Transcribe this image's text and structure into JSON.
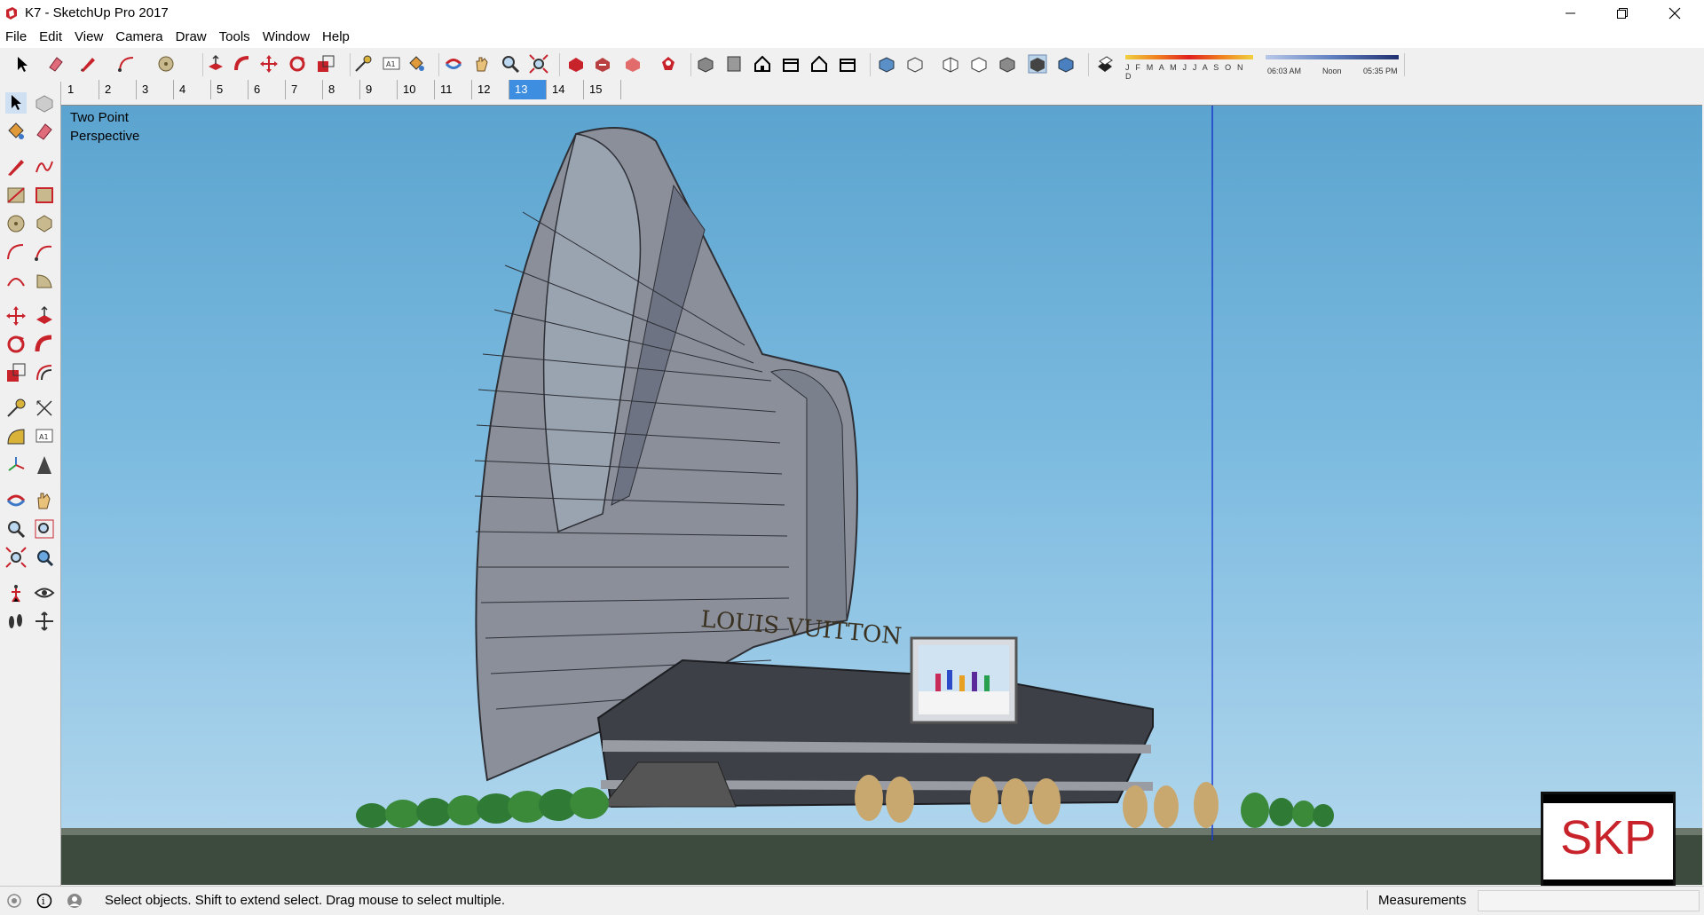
{
  "window": {
    "title": "K7 - SketchUp Pro 2017"
  },
  "menu": [
    "File",
    "Edit",
    "View",
    "Camera",
    "Draw",
    "Tools",
    "Window",
    "Help"
  ],
  "shadows": {
    "months": "J F M A M J J A S O N D",
    "sunrise": "06:03 AM",
    "noon": "Noon",
    "sunset": "05:35 PM"
  },
  "scenes": {
    "tabs": [
      "1",
      "2",
      "3",
      "4",
      "5",
      "6",
      "7",
      "8",
      "9",
      "10",
      "11",
      "12",
      "13",
      "14",
      "15"
    ],
    "active": "13"
  },
  "viewport": {
    "camera_label_line1": "Two Point",
    "camera_label_line2": "Perspective",
    "sign_text": "LOUIS VUITTON"
  },
  "badge": {
    "text": "SKP"
  },
  "status": {
    "hint": "Select objects. Shift to extend select. Drag mouse to select multiple.",
    "measurements_label": "Measurements"
  },
  "colors": {
    "sky_top": "#5ba4cf",
    "sky_bottom": "#b6d9ee",
    "accent_tab": "#3d8ee0",
    "badge_red": "#c8232b"
  }
}
